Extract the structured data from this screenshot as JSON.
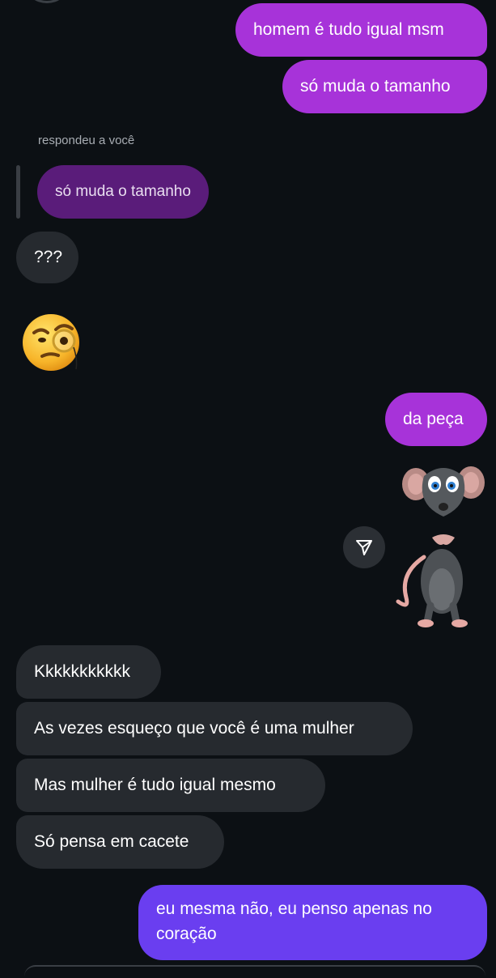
{
  "messages": {
    "out_1": "homem é tudo igual msm",
    "out_2": "só muda o tamanho",
    "reply_label": "respondeu a você",
    "reply_quote": "só muda o tamanho",
    "in_1": "???",
    "emoji": "monocle-face-emoji",
    "out_3": "da peça",
    "sticker": "mouse-sticker",
    "in_2": "Kkkkkkkkkkk",
    "in_3": "As vezes esqueço que você é uma mulher",
    "in_4": "Mas mulher é tudo igual mesmo",
    "in_5": "Só pensa em cacete",
    "out_4": "eu mesma não, eu penso apenas no coração"
  },
  "icons": {
    "share": "send-icon"
  },
  "colors": {
    "background": "#0c1014",
    "outgoing_purple": "#a733d9",
    "outgoing_violet": "#6a3ef0",
    "incoming": "#262a2f",
    "reply_quote": "#5a1c7a"
  }
}
